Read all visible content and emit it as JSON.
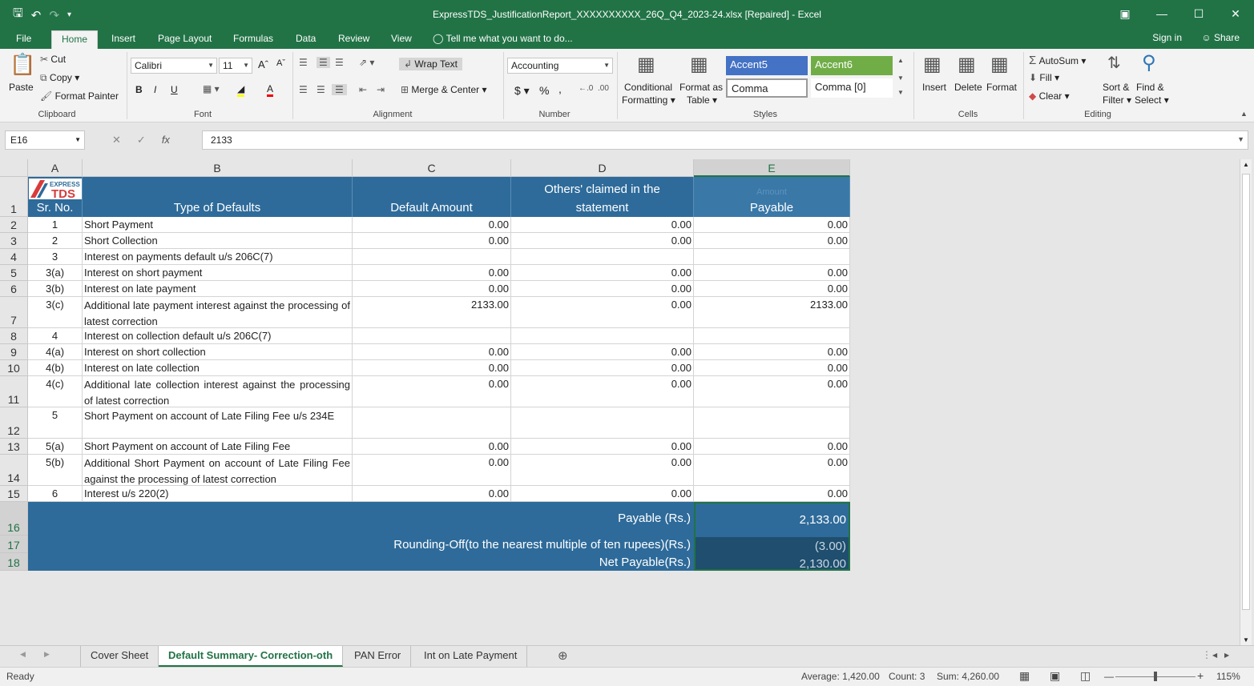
{
  "window": {
    "title": "ExpressTDS_JustificationReport_XXXXXXXXXX_26Q_Q4_2023-24.xlsx [Repaired] - Excel"
  },
  "ribbon_tabs": [
    "File",
    "Home",
    "Insert",
    "Page Layout",
    "Formulas",
    "Data",
    "Review",
    "View"
  ],
  "tell_me": "Tell me what you want to do...",
  "sign_in": "Sign in",
  "share": "Share",
  "clipboard": {
    "paste": "Paste",
    "cut": "Cut",
    "copy": "Copy",
    "format_painter": "Format Painter",
    "label": "Clipboard"
  },
  "font": {
    "name": "Calibri",
    "size": "11",
    "bold": "B",
    "italic": "I",
    "underline": "U",
    "label": "Font"
  },
  "alignment": {
    "wrap_text": "Wrap Text",
    "merge_center": "Merge & Center",
    "label": "Alignment"
  },
  "number": {
    "format": "Accounting",
    "currency": "$",
    "percent": "%",
    "comma": ",",
    "label": "Number"
  },
  "styles": {
    "conditional": "Conditional",
    "conditional2": "Formatting",
    "format_as": "Format as",
    "format_as2": "Table",
    "accent5": "Accent5",
    "accent6": "Accent6",
    "comma": "Comma",
    "comma0": "Comma [0]",
    "label": "Styles"
  },
  "cells_group": {
    "insert": "Insert",
    "delete": "Delete",
    "format": "Format",
    "label": "Cells"
  },
  "editing": {
    "autosum": "AutoSum",
    "fill": "Fill",
    "clear": "Clear",
    "sort": "Sort &",
    "sort2": "Filter",
    "find": "Find &",
    "find2": "Select",
    "label": "Editing"
  },
  "formula_bar": {
    "name_box": "E16",
    "fx": "fx",
    "value": "2133"
  },
  "columns": [
    "A",
    "B",
    "C",
    "D",
    "E"
  ],
  "logo": {
    "line1": "EXPRESS",
    "line2": "TDS"
  },
  "header": {
    "sr_no": "Sr. No.",
    "type": "Type of Defaults",
    "default_amount": "Default Amount",
    "others_claimed_1": "Others' claimed in the",
    "others_claimed_2": "statement",
    "payable_faded": "Amount",
    "payable": "Payable"
  },
  "rows": [
    {
      "n": "2",
      "sr": "1",
      "type": "Short Payment",
      "c": "0.00",
      "d": "0.00",
      "e": "0.00"
    },
    {
      "n": "3",
      "sr": "2",
      "type": "Short Collection",
      "c": "0.00",
      "d": "0.00",
      "e": "0.00"
    },
    {
      "n": "4",
      "sr": "3",
      "type": "Interest on payments default u/s 206C(7)",
      "c": "",
      "d": "",
      "e": ""
    },
    {
      "n": "5",
      "sr": "3(a)",
      "type": "Interest on short payment",
      "c": "0.00",
      "d": "0.00",
      "e": "0.00"
    },
    {
      "n": "6",
      "sr": "3(b)",
      "type": "Interest on late payment",
      "c": "0.00",
      "d": "0.00",
      "e": "0.00"
    },
    {
      "n": "7",
      "sr": "3(c)",
      "type": "Additional late payment interest against the processing of latest correction",
      "c": "2133.00",
      "d": "0.00",
      "e": "2133.00"
    },
    {
      "n": "8",
      "sr": "4",
      "type": "Interest on collection default u/s 206C(7)",
      "c": "",
      "d": "",
      "e": ""
    },
    {
      "n": "9",
      "sr": "4(a)",
      "type": "Interest on short collection",
      "c": "0.00",
      "d": "0.00",
      "e": "0.00"
    },
    {
      "n": "10",
      "sr": "4(b)",
      "type": "Interest on late collection",
      "c": "0.00",
      "d": "0.00",
      "e": "0.00"
    },
    {
      "n": "11",
      "sr": "4(c)",
      "type": "Additional late collection interest against the processing of latest correction",
      "c": "0.00",
      "d": "0.00",
      "e": "0.00"
    },
    {
      "n": "12",
      "sr": "5",
      "type": "Short Payment on account of Late Filing Fee u/s 234E",
      "c": "",
      "d": "",
      "e": ""
    },
    {
      "n": "13",
      "sr": "5(a)",
      "type": "Short Payment on account of Late Filing Fee",
      "c": "0.00",
      "d": "0.00",
      "e": "0.00"
    },
    {
      "n": "14",
      "sr": "5(b)",
      "type": "Additional Short Payment on account of Late Filing Fee against the processing of latest correction",
      "c": "0.00",
      "d": "0.00",
      "e": "0.00"
    },
    {
      "n": "15",
      "sr": "6",
      "type": "Interest u/s 220(2)",
      "c": "0.00",
      "d": "0.00",
      "e": "0.00"
    }
  ],
  "summary": {
    "payable_label": "Payable (Rs.)",
    "payable_value": "2,133.00",
    "rounding_label": "Rounding-Off(to the nearest multiple of ten rupees)(Rs.)",
    "rounding_value": "(3.00)",
    "net_label": "Net Payable(Rs.)",
    "net_value": "2,130.00"
  },
  "row_numbers": {
    "r1": "1",
    "r16": "16",
    "r17": "17",
    "r18": "18"
  },
  "sheet_tabs": [
    "Cover Sheet",
    "Default Summary- Correction-oth",
    "PAN Error",
    "Int on Late Payment"
  ],
  "status": {
    "ready": "Ready",
    "average": "Average: 1,420.00",
    "count": "Count: 3",
    "sum": "Sum: 4,260.00",
    "zoom": "115%"
  }
}
